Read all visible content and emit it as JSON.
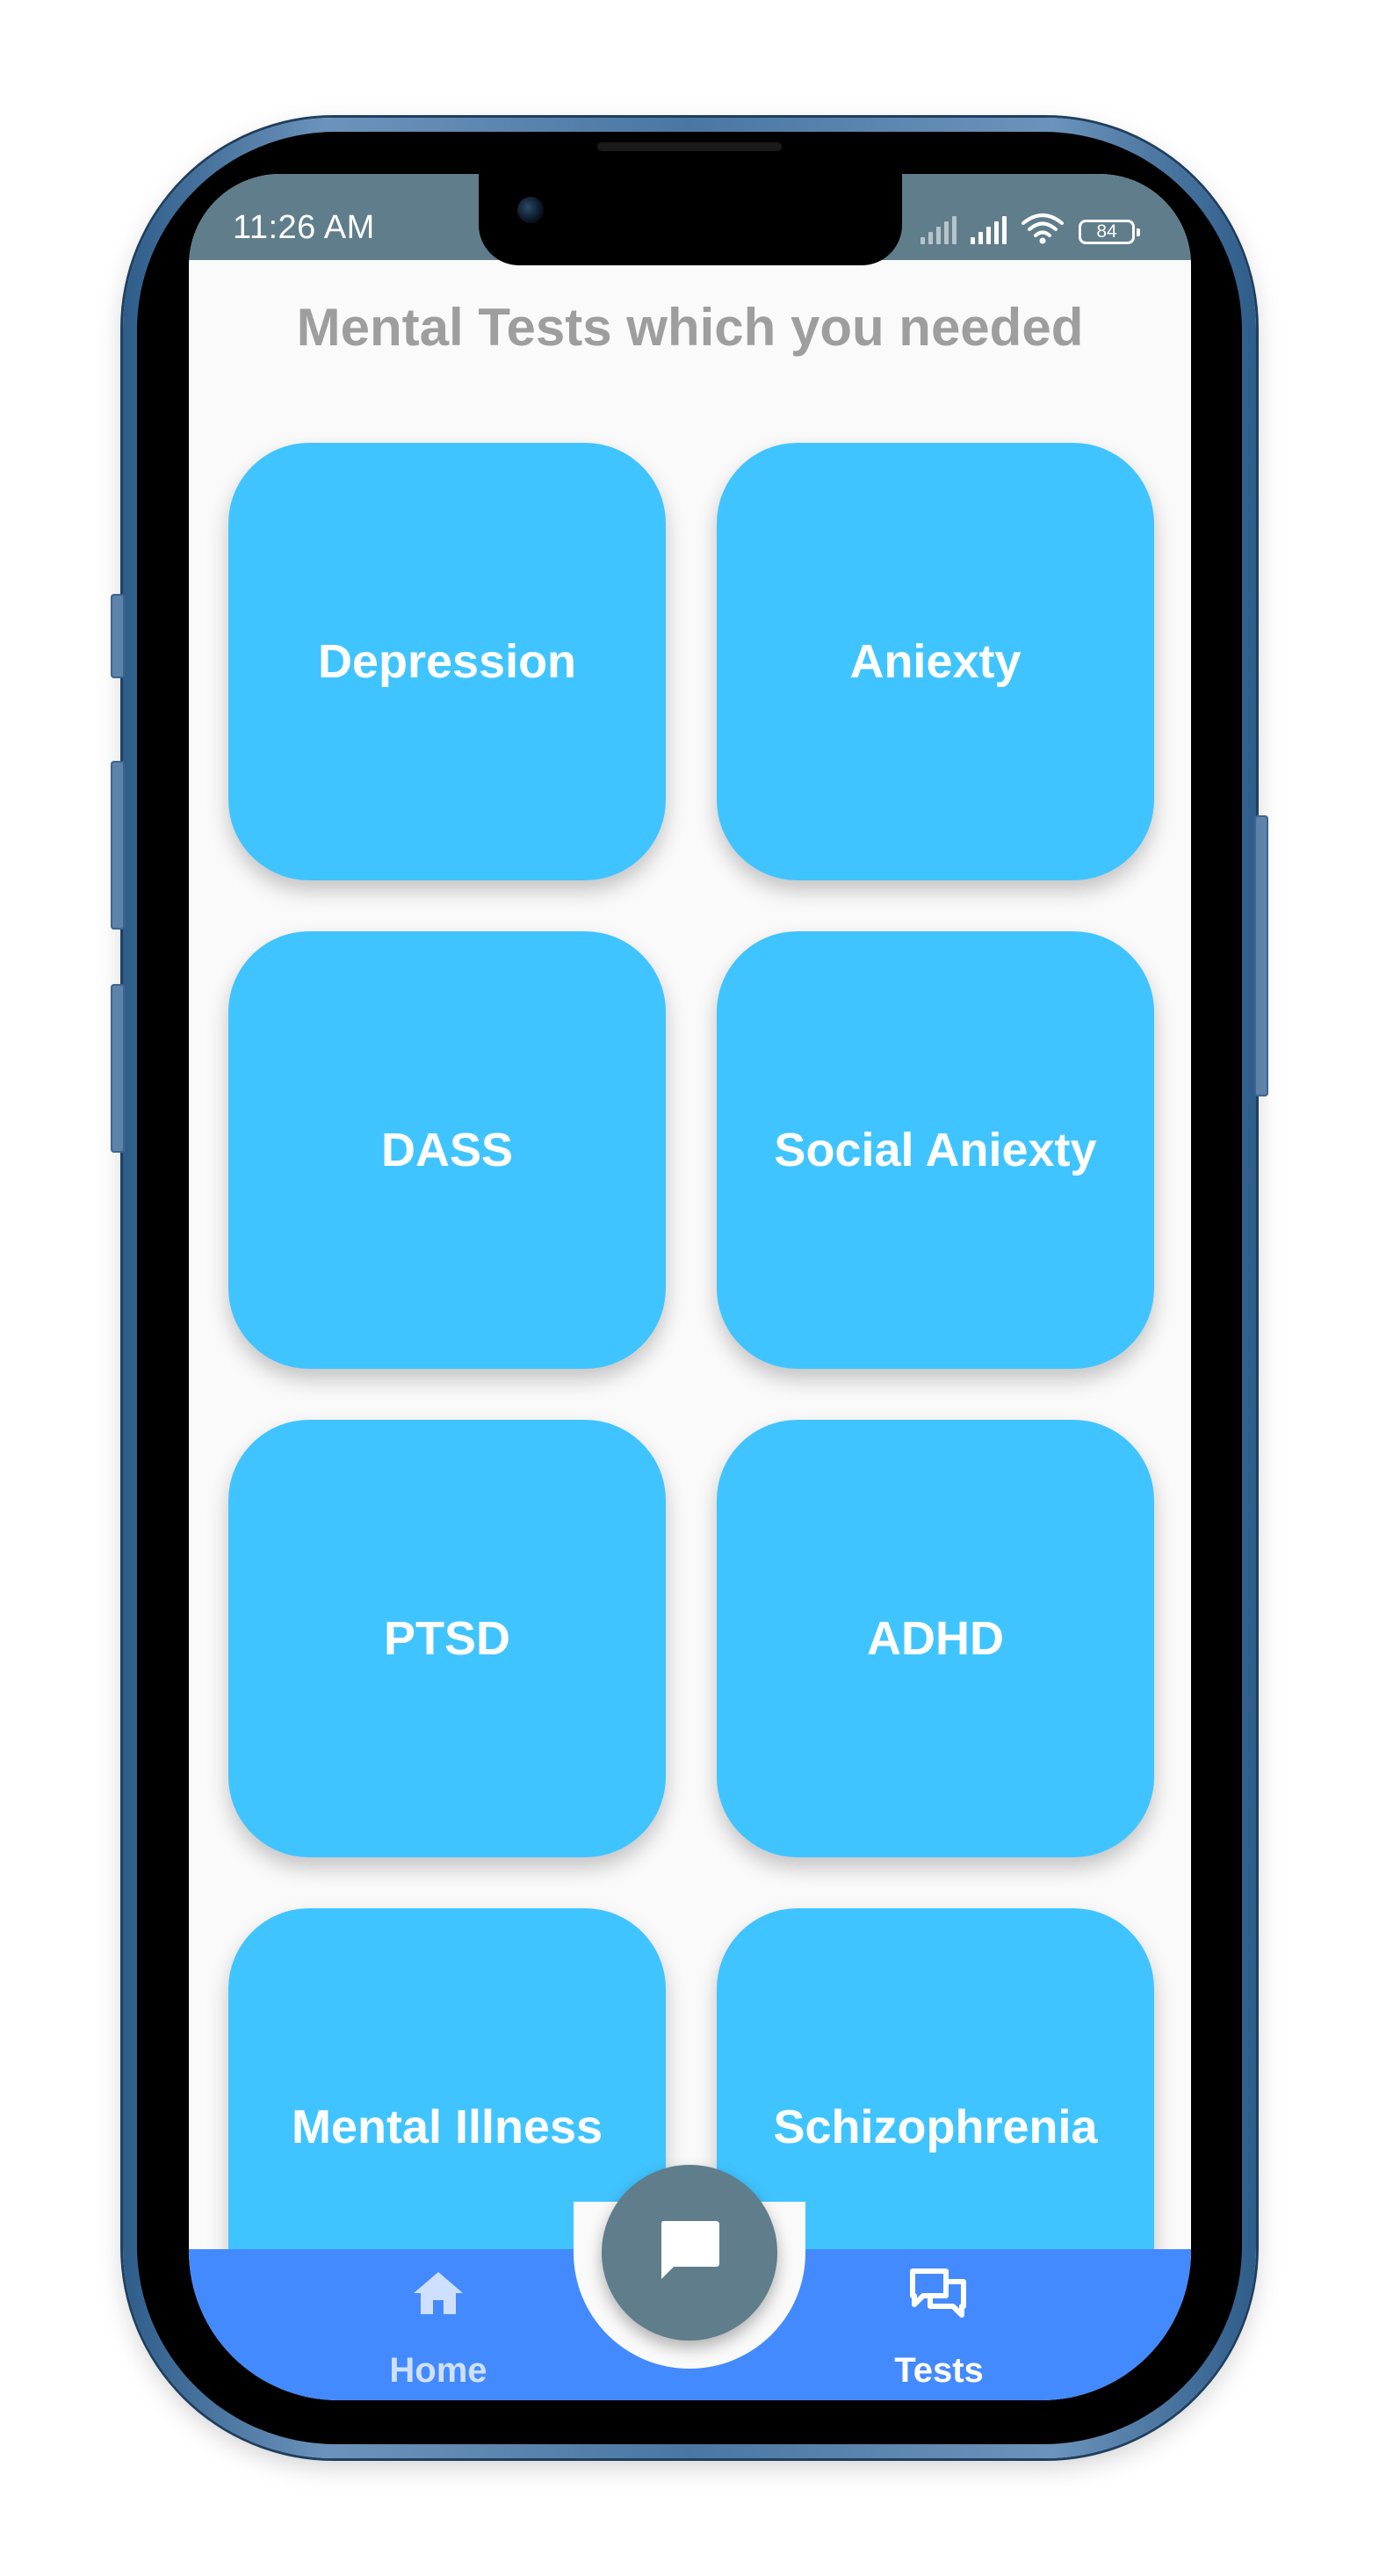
{
  "status_bar": {
    "time": "11:26 AM",
    "battery": "84",
    "icons": [
      "signal-bars-icon",
      "signal-bars-icon",
      "wifi-icon",
      "battery-icon"
    ]
  },
  "page": {
    "title": "Mental Tests which you needed"
  },
  "tests": [
    {
      "label": "Depression"
    },
    {
      "label": "Aniexty"
    },
    {
      "label": "DASS"
    },
    {
      "label": "Social Aniexty"
    },
    {
      "label": "PTSD"
    },
    {
      "label": "ADHD"
    },
    {
      "label": "Mental Illness"
    },
    {
      "label": "Schizophrenia"
    }
  ],
  "bottom_nav": {
    "home_label": "Home",
    "home_icon": "home-icon",
    "tests_label": "Tests",
    "tests_icon": "forum-icon",
    "fab_icon": "chat-icon"
  },
  "colors": {
    "status_bar": "#607d8b",
    "tile": "#40c4ff",
    "nav_bar": "#448aff",
    "fab": "#607d8b",
    "title_text": "#9e9e9e",
    "phone_frame": "#4b76a3"
  }
}
